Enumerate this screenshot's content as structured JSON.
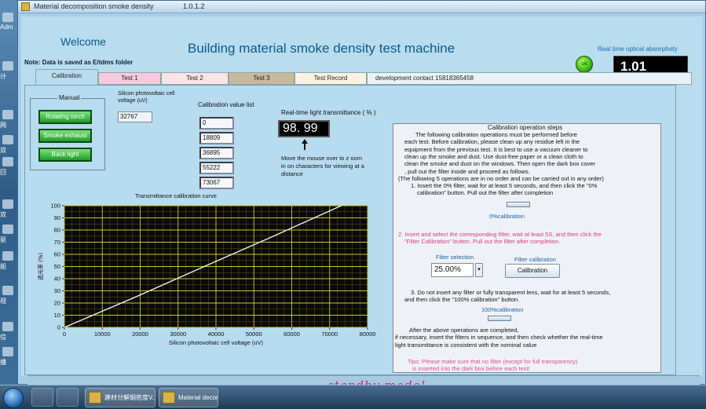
{
  "window": {
    "title": "Material decomposition smoke density",
    "version": "1.0.1.2"
  },
  "desktop": {
    "labels": [
      "Adm",
      "计",
      "网",
      "双",
      "回",
      "双",
      "驱",
      "船",
      "视",
      "信",
      "播"
    ]
  },
  "header": {
    "welcome": "Welcome",
    "note": "Note: Data is saved as E/tdms folder",
    "title": "Building material smoke density test machine",
    "realtime_label": "Real time optical absorptivity",
    "ok_label": "ok",
    "realtime_value": "1.01"
  },
  "tabs": [
    {
      "label": "Calibration",
      "color": "#b9dcef"
    },
    {
      "label": "Test 1",
      "color": "#f8c8dc"
    },
    {
      "label": "Test 2",
      "color": "#fbe3e6"
    },
    {
      "label": "Test 3",
      "color": "#c9b99a"
    },
    {
      "label": "Test Record",
      "color": "#fdf2e2"
    },
    {
      "label": "development   contact 15818365458",
      "color": "#eaf2f8"
    }
  ],
  "manual": {
    "title": "Manual",
    "buttons": [
      "Rotating torch",
      "Smoke exhaust",
      "Back light"
    ]
  },
  "cell_voltage": {
    "label": "Silicon photovoltaic cell voltage (uV)",
    "value": "32767"
  },
  "calibration_list": {
    "label": "Calibration value list",
    "values": [
      "0",
      "18809",
      "36895",
      "55222",
      "73067"
    ]
  },
  "transmittance": {
    "label": "Real-time light transmittance ( % )",
    "value": "98. 99",
    "hint": "Move the mouse over to z oom in on characters for viewing at a distance"
  },
  "chart_data": {
    "type": "line",
    "title": "Transmittance calibration curve",
    "xlabel": "Silicon photovoltaic cell voltage (uV)",
    "ylabel": "透光率 (%)",
    "xlim": [
      0,
      80000
    ],
    "ylim": [
      0,
      100
    ],
    "x_ticks": [
      "0",
      "10000",
      "20000",
      "30000",
      "40000",
      "50000",
      "60000",
      "70000",
      "80000"
    ],
    "y_ticks": [
      "0",
      "10",
      "20",
      "30",
      "40",
      "50",
      "60",
      "70",
      "80",
      "90",
      "100"
    ],
    "grid": true,
    "series": [
      {
        "x": [
          0,
          18809,
          36895,
          55222,
          73067
        ],
        "y": [
          0,
          25,
          50,
          75,
          100
        ],
        "color": "#f0f0f0"
      }
    ],
    "background": "#0a0a0a",
    "grid_color": "#d9d226"
  },
  "steps": {
    "title": "Calibration operation steps",
    "intro": [
      "The following calibration operations must be performed before",
      "each test. Before calibration, please clean up any residue left in the",
      "equipment from the previous test. It is best to use a vacuum cleaner to",
      "clean up the smoke and dust. Use dust-free paper or a clean cloth to",
      "clean the smoke and dust on the windows. Then open the dark box cover",
      ", pull out the filter inside and proceed as follows.",
      "(The following 5 operations are in no order and can be carried out in any order)",
      "1. Insert the 0% filter, wait for at least 5 seconds, and then click the \"0%",
      "calibration\" button. Pull out the filter after completion"
    ],
    "zero_cal_label": "0%calibration",
    "step2": [
      "2. Insert and select the corresponding filter, wait at least 5S, and then click the",
      "\"Filter Calibration\" button. Pull out the filter after completion."
    ],
    "filter_selection_label": "Filter selection",
    "filter_value": "25.00%",
    "filter_cal_label": "Filter calibration",
    "calibration_button": "Calibration",
    "step3": [
      "3. Do not insert any filter or fully transparent lens, wait for at least 5 seconds,",
      "and then click the \"100% calibration\" button."
    ],
    "full_cal_label": "100%calibration",
    "after": [
      "After the above operations are completed,",
      "if necessary, insert the filters in sequence, and then check whether the real-time",
      "light transmittance is consistent with the nominal value"
    ],
    "tips": [
      "Tips: Please make sure that no filter (except for full transparency)",
      "is inserted into the dark box before each test!"
    ]
  },
  "status": {
    "mode": "standby mode!"
  },
  "taskbar": {
    "task1": "建材分解烟密度V...",
    "task2": "Material decom..."
  }
}
